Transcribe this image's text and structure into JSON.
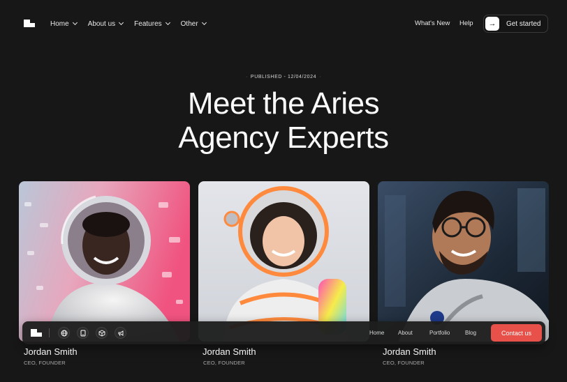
{
  "nav": {
    "items": [
      {
        "label": "Home"
      },
      {
        "label": "About us"
      },
      {
        "label": "Features"
      },
      {
        "label": "Other"
      }
    ],
    "whats_new": "What's New",
    "help": "Help",
    "cta_label": "Get started"
  },
  "hero": {
    "published": "PUBLISHED - 12/04/2024",
    "title_line1": "Meet the Aries",
    "title_line2": "Agency Experts"
  },
  "team": [
    {
      "name": "Jordan Smith",
      "role": "CEO, FOUNDER"
    },
    {
      "name": "Jordan Smith",
      "role": "CEO, FOUNDER"
    },
    {
      "name": "Jordan Smith",
      "role": "CEO, FOUNDER"
    }
  ],
  "bottom_bar": {
    "icons": [
      "globe-icon",
      "tablet-icon",
      "cube-icon",
      "megaphone-icon"
    ],
    "links": [
      {
        "label": "Home"
      },
      {
        "label": "About"
      },
      {
        "label": "Portfolio"
      },
      {
        "label": "Blog"
      }
    ],
    "contact_label": "Contact us"
  },
  "colors": {
    "background": "#171717",
    "accent": "#e8514a"
  }
}
